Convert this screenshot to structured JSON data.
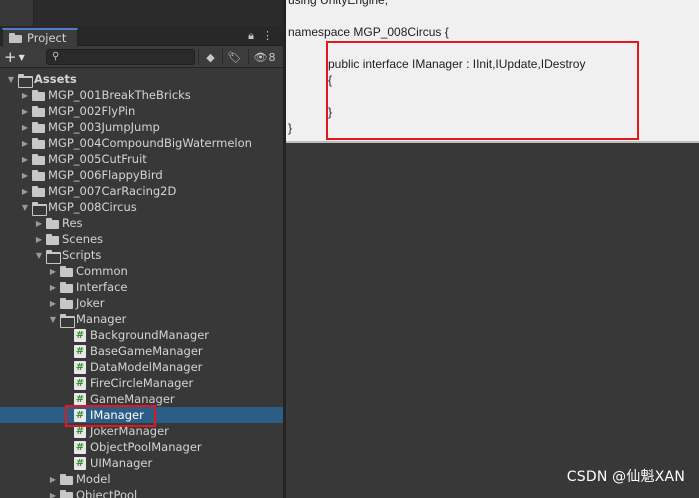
{
  "project_tab": {
    "label": "Project"
  },
  "toolbar": {
    "add_label": "+",
    "search_placeholder": "",
    "hidden_count": "8"
  },
  "tree": [
    {
      "label": "Assets",
      "depth": 0,
      "arrow": "open",
      "icon": "folder-open",
      "bold": true
    },
    {
      "label": "MGP_001BreakTheBricks",
      "depth": 1,
      "arrow": "closed",
      "icon": "folder"
    },
    {
      "label": "MGP_002FlyPin",
      "depth": 1,
      "arrow": "closed",
      "icon": "folder"
    },
    {
      "label": "MGP_003JumpJump",
      "depth": 1,
      "arrow": "closed",
      "icon": "folder"
    },
    {
      "label": "MGP_004CompoundBigWatermelon",
      "depth": 1,
      "arrow": "closed",
      "icon": "folder"
    },
    {
      "label": "MGP_005CutFruit",
      "depth": 1,
      "arrow": "closed",
      "icon": "folder"
    },
    {
      "label": "MGP_006FlappyBird",
      "depth": 1,
      "arrow": "closed",
      "icon": "folder"
    },
    {
      "label": "MGP_007CarRacing2D",
      "depth": 1,
      "arrow": "closed",
      "icon": "folder"
    },
    {
      "label": "MGP_008Circus",
      "depth": 1,
      "arrow": "open",
      "icon": "folder-open"
    },
    {
      "label": "Res",
      "depth": 2,
      "arrow": "closed",
      "icon": "folder"
    },
    {
      "label": "Scenes",
      "depth": 2,
      "arrow": "closed",
      "icon": "folder"
    },
    {
      "label": "Scripts",
      "depth": 2,
      "arrow": "open",
      "icon": "folder-open"
    },
    {
      "label": "Common",
      "depth": 3,
      "arrow": "closed",
      "icon": "folder"
    },
    {
      "label": "Interface",
      "depth": 3,
      "arrow": "closed",
      "icon": "folder"
    },
    {
      "label": "Joker",
      "depth": 3,
      "arrow": "closed",
      "icon": "folder"
    },
    {
      "label": "Manager",
      "depth": 3,
      "arrow": "open",
      "icon": "folder-open"
    },
    {
      "label": "BackgroundManager",
      "depth": 4,
      "arrow": "none",
      "icon": "csharp"
    },
    {
      "label": "BaseGameManager",
      "depth": 4,
      "arrow": "none",
      "icon": "csharp"
    },
    {
      "label": "DataModelManager",
      "depth": 4,
      "arrow": "none",
      "icon": "csharp"
    },
    {
      "label": "FireCircleManager",
      "depth": 4,
      "arrow": "none",
      "icon": "csharp"
    },
    {
      "label": "GameManager",
      "depth": 4,
      "arrow": "none",
      "icon": "csharp"
    },
    {
      "label": "IManager",
      "depth": 4,
      "arrow": "none",
      "icon": "csharp",
      "selected": true
    },
    {
      "label": "JokerManager",
      "depth": 4,
      "arrow": "none",
      "icon": "csharp"
    },
    {
      "label": "ObjectPoolManager",
      "depth": 4,
      "arrow": "none",
      "icon": "csharp"
    },
    {
      "label": "UIManager",
      "depth": 4,
      "arrow": "none",
      "icon": "csharp"
    },
    {
      "label": "Model",
      "depth": 3,
      "arrow": "closed",
      "icon": "folder"
    },
    {
      "label": "ObjectPool",
      "depth": 3,
      "arrow": "closed",
      "icon": "folder"
    }
  ],
  "code": {
    "lines": [
      "using UnityEngine;",
      "",
      "namespace MGP_008Circus {",
      "",
      "            public interface IManager : IInit,IUpdate,IDestroy",
      "            {",
      "",
      "            }",
      "}"
    ]
  },
  "watermark": "CSDN @仙魁XAN"
}
